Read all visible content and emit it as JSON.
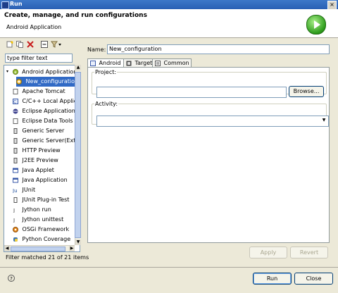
{
  "window": {
    "title": "Run",
    "close_glyph": "×"
  },
  "header": {
    "title": "Create, manage, and run configurations",
    "subtitle": "Android Application",
    "icon": "run-icon"
  },
  "left_panel": {
    "toolbar_icons": [
      "new-config-icon",
      "duplicate-icon",
      "delete-icon",
      "collapse-all-icon",
      "filter-icon"
    ],
    "filter_placeholder": "type filter text",
    "tree": [
      {
        "label": "Android Application",
        "expanded": true,
        "icon": "android-app-icon"
      },
      {
        "label": "New_configuration",
        "selected": true,
        "icon": "config-icon"
      },
      {
        "label": "Apache Tomcat",
        "icon": "tomcat-icon"
      },
      {
        "label": "C/C++ Local Application",
        "icon": "cpp-icon"
      },
      {
        "label": "Eclipse Application",
        "icon": "eclipse-icon"
      },
      {
        "label": "Eclipse Data Tools",
        "icon": "data-tools-icon"
      },
      {
        "label": "Generic Server",
        "icon": "server-icon"
      },
      {
        "label": "Generic Server(External Launch)",
        "icon": "server-icon"
      },
      {
        "label": "HTTP Preview",
        "icon": "http-icon"
      },
      {
        "label": "J2EE Preview",
        "icon": "j2ee-icon"
      },
      {
        "label": "Java Applet",
        "icon": "applet-icon"
      },
      {
        "label": "Java Application",
        "icon": "java-app-icon"
      },
      {
        "label": "JUnit",
        "icon": "junit-icon"
      },
      {
        "label": "JUnit Plug-in Test",
        "icon": "junit-plugin-icon"
      },
      {
        "label": "Jython run",
        "icon": "jython-icon"
      },
      {
        "label": "Jython unittest",
        "icon": "jython-icon"
      },
      {
        "label": "OSGi Framework",
        "icon": "osgi-icon"
      },
      {
        "label": "Python Coverage",
        "icon": "python-icon"
      }
    ],
    "filter_status": "Filter matched 21 of 21 items"
  },
  "right_panel": {
    "name_label": "Name:",
    "name_value": "New_configuration",
    "tabs": [
      {
        "label": "Android",
        "active": true,
        "icon": "android-tab-icon"
      },
      {
        "label": "Target",
        "icon": "target-tab-icon"
      },
      {
        "label": "Common",
        "icon": "common-tab-icon"
      }
    ],
    "project_label": "Project:",
    "project_value": "",
    "browse_label": "Browse...",
    "activity_label": "Activity:",
    "activity_value": "",
    "apply_label": "Apply",
    "revert_label": "Revert"
  },
  "footer": {
    "help_glyph": "?",
    "run_label": "Run",
    "close_label": "Close"
  },
  "colors": {
    "accent": "#316ac5",
    "title_bar": "#2a5fb4",
    "run_green": "#2e9c1c"
  }
}
